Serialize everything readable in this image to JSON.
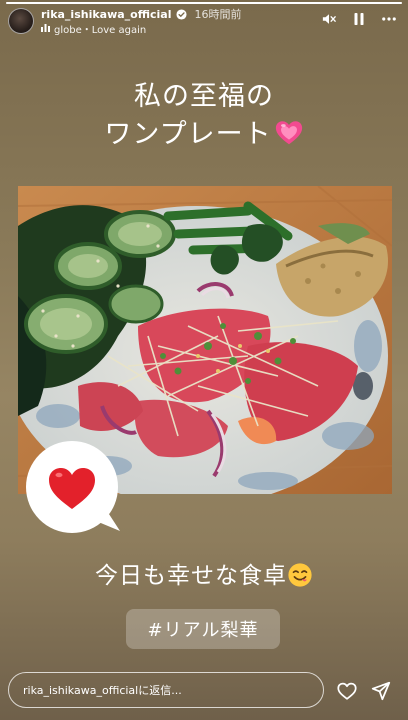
{
  "story": {
    "progress": 1.0
  },
  "header": {
    "username": "rika_ishikawa_official",
    "time_ago": "16時間前",
    "music": "globe・Love again",
    "verified": true,
    "controls": [
      "mute-icon",
      "pause-icon",
      "more-icon"
    ]
  },
  "title": {
    "line1": "私の至福の",
    "line2": "ワンプレート",
    "emoji": "growing-heart-emoji"
  },
  "photo": {
    "subject": "plate-photo"
  },
  "sticker": {
    "emoji": "red-heart-emoji"
  },
  "caption": {
    "text": "今日も幸せな食卓",
    "emoji": "yum-face-emoji"
  },
  "hashtag": {
    "text": "#リアル梨華"
  },
  "footer": {
    "reply_placeholder": "rika_ishikawa_officialに返信...",
    "icons": [
      "heart-icon",
      "send-icon"
    ]
  },
  "colors": {
    "background_top": "#7a6a4c",
    "background_mid": "#968563",
    "heart_red": "#e3212b",
    "heart_pink": "#f24a90"
  }
}
